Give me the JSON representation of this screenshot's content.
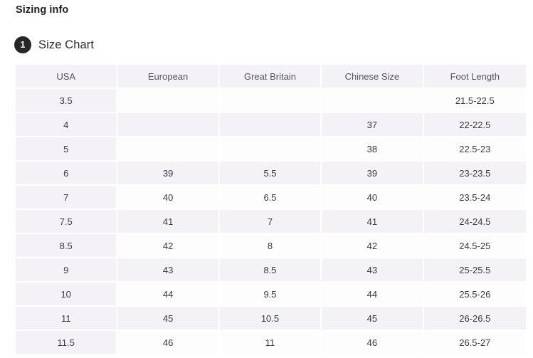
{
  "page": {
    "title": "Sizing info"
  },
  "section": {
    "badge": "1",
    "title": "Size Chart"
  },
  "colors": {
    "page_background": "#ffffff",
    "header_background": "#f4f2f6",
    "row_shaded": "#f4f2f6",
    "row_plain": "#fdfdfd",
    "badge_background": "#26262a",
    "text_primary": "#2b2b2b",
    "text_header": "#555558",
    "grid_line": "#ffffff"
  },
  "table": {
    "columns": [
      "USA",
      "European",
      "Great Britain",
      "Chinese Size",
      "Foot Length"
    ],
    "rows": [
      {
        "shaded": false,
        "cells": [
          "3.5",
          "",
          "",
          "",
          "21.5-22.5"
        ]
      },
      {
        "shaded": true,
        "cells": [
          "4",
          "",
          "",
          "37",
          "22-22.5"
        ]
      },
      {
        "shaded": false,
        "cells": [
          "5",
          "",
          "",
          "38",
          "22.5-23"
        ]
      },
      {
        "shaded": true,
        "cells": [
          "6",
          "39",
          "5.5",
          "39",
          "23-23.5"
        ]
      },
      {
        "shaded": false,
        "cells": [
          "7",
          "40",
          "6.5",
          "40",
          "23.5-24"
        ]
      },
      {
        "shaded": true,
        "cells": [
          "7.5",
          "41",
          "7",
          "41",
          "24-24.5"
        ]
      },
      {
        "shaded": false,
        "cells": [
          "8.5",
          "42",
          "8",
          "42",
          "24.5-25"
        ]
      },
      {
        "shaded": true,
        "cells": [
          "9",
          "43",
          "8.5",
          "43",
          "25-25.5"
        ]
      },
      {
        "shaded": false,
        "cells": [
          "10",
          "44",
          "9.5",
          "44",
          "25.5-26"
        ]
      },
      {
        "shaded": true,
        "cells": [
          "11",
          "45",
          "10.5",
          "45",
          "26-26.5"
        ]
      },
      {
        "shaded": false,
        "cells": [
          "11.5",
          "46",
          "11",
          "46",
          "26.5-27"
        ]
      }
    ]
  }
}
